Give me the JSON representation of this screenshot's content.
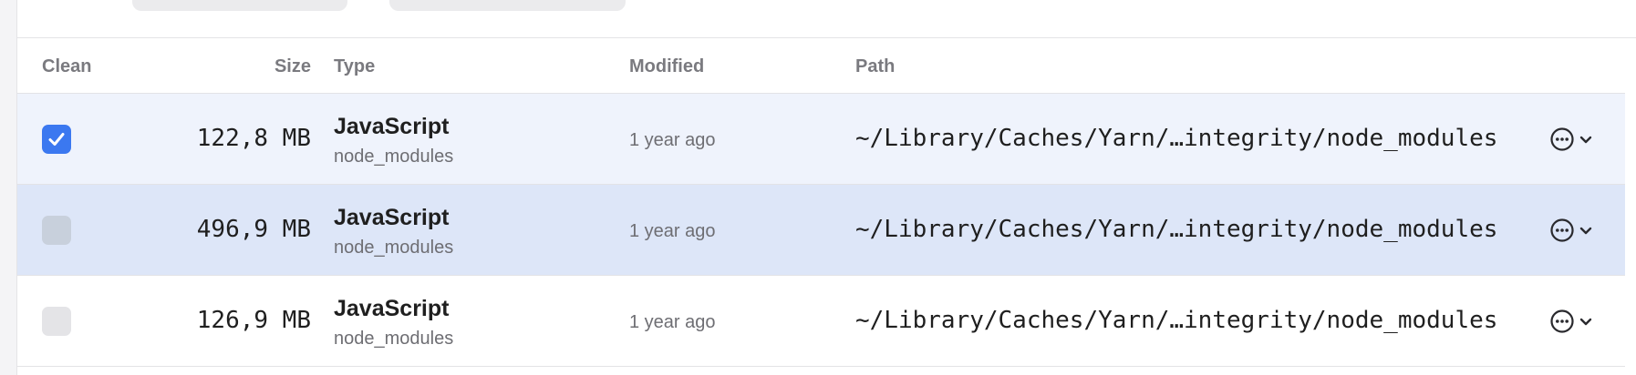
{
  "table": {
    "headers": {
      "clean": "Clean",
      "size": "Size",
      "type": "Type",
      "modified": "Modified",
      "path": "Path"
    },
    "rows": [
      {
        "checked": true,
        "size": "122,8 MB",
        "type": "JavaScript",
        "subtype": "node_modules",
        "modified": "1 year ago",
        "path": "~/Library/Caches/Yarn/…integrity/node_modules"
      },
      {
        "checked": false,
        "size": "496,9 MB",
        "type": "JavaScript",
        "subtype": "node_modules",
        "modified": "1 year ago",
        "path": "~/Library/Caches/Yarn/…integrity/node_modules"
      },
      {
        "checked": false,
        "size": "126,9 MB",
        "type": "JavaScript",
        "subtype": "node_modules",
        "modified": "1 year ago",
        "path": "~/Library/Caches/Yarn/…integrity/node_modules"
      }
    ]
  },
  "icons": {
    "checkbox": "checkmark-icon",
    "more": "ellipsis-circle-icon",
    "expand": "chevron-down-icon"
  },
  "colors": {
    "accent": "#3b78f0",
    "row_checked_bg": "#eff3fc",
    "row_selected_bg": "#dde6f8"
  }
}
